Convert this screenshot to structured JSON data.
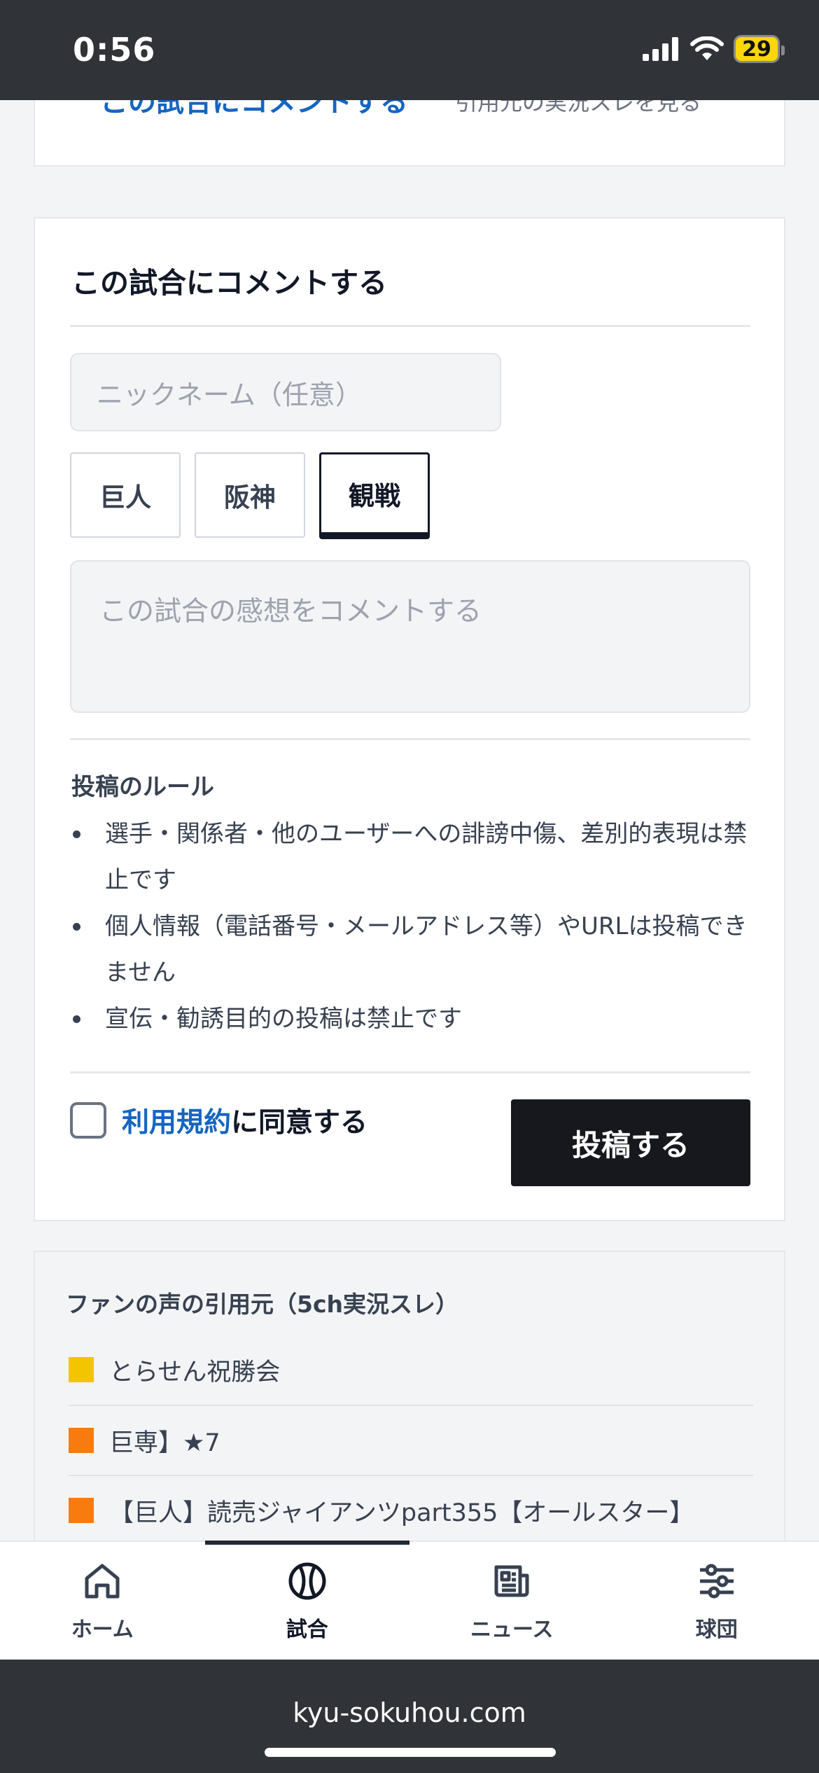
{
  "status_bar": {
    "time": "0:56",
    "battery": "29"
  },
  "top_fragment": {
    "link": "この試合にコメントする",
    "sub": "引用元の実況スレを見る"
  },
  "comment_form": {
    "title": "この試合にコメントする",
    "nickname_placeholder": "ニックネーム（任意）",
    "teams": [
      "巨人",
      "阪神",
      "観戦"
    ],
    "selected_team": "観戦",
    "comment_placeholder": "この試合の感想をコメントする",
    "rules_title": "投稿のルール",
    "rules": [
      "選手・関係者・他のユーザーへの誹謗中傷、差別的表現は禁止です",
      "個人情報（電話番号・メールアドレス等）やURLは投稿できません",
      "宣伝・勧誘目的の投稿は禁止です"
    ],
    "terms_link": "利用規約",
    "agree_suffix": "に同意する",
    "submit_label": "投稿する"
  },
  "sources": {
    "title": "ファンの声の引用元（5ch実況スレ）",
    "items": [
      {
        "label": "とらせん祝勝会",
        "color": "#f2c500"
      },
      {
        "label": "巨専】★7",
        "color": "#f77b0e"
      },
      {
        "label": "【巨人】読売ジャイアンツpart355【オールスター】",
        "color": "#f77b0e"
      }
    ]
  },
  "tab_bar": {
    "items": [
      {
        "label": "ホーム",
        "icon": "home-icon"
      },
      {
        "label": "試合",
        "icon": "baseball-icon"
      },
      {
        "label": "ニュース",
        "icon": "newspaper-icon"
      },
      {
        "label": "球団",
        "icon": "team-icon"
      }
    ],
    "active": "試合"
  },
  "browser": {
    "url": "kyu-sokuhou.com"
  }
}
